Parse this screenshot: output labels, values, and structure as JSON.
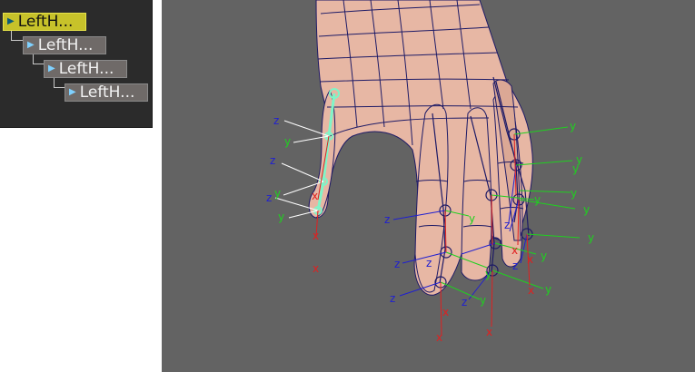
{
  "outliner": {
    "nodes": [
      {
        "label": "LeftH...",
        "selected": true
      },
      {
        "label": "LeftH...",
        "selected": false
      },
      {
        "label": "LeftH...",
        "selected": false
      },
      {
        "label": "LeftH...",
        "selected": false
      }
    ]
  },
  "viewport": {
    "axis_labels": {
      "x": "x",
      "y": "y",
      "z": "z"
    },
    "colors": {
      "background": "#636363",
      "skin": "#e7b7a4",
      "wire": "#1d1a66",
      "axis_x": "#e02020",
      "axis_y": "#20d020",
      "axis_z": "#2020d0",
      "selected_joint": "#7ff5c8"
    }
  }
}
